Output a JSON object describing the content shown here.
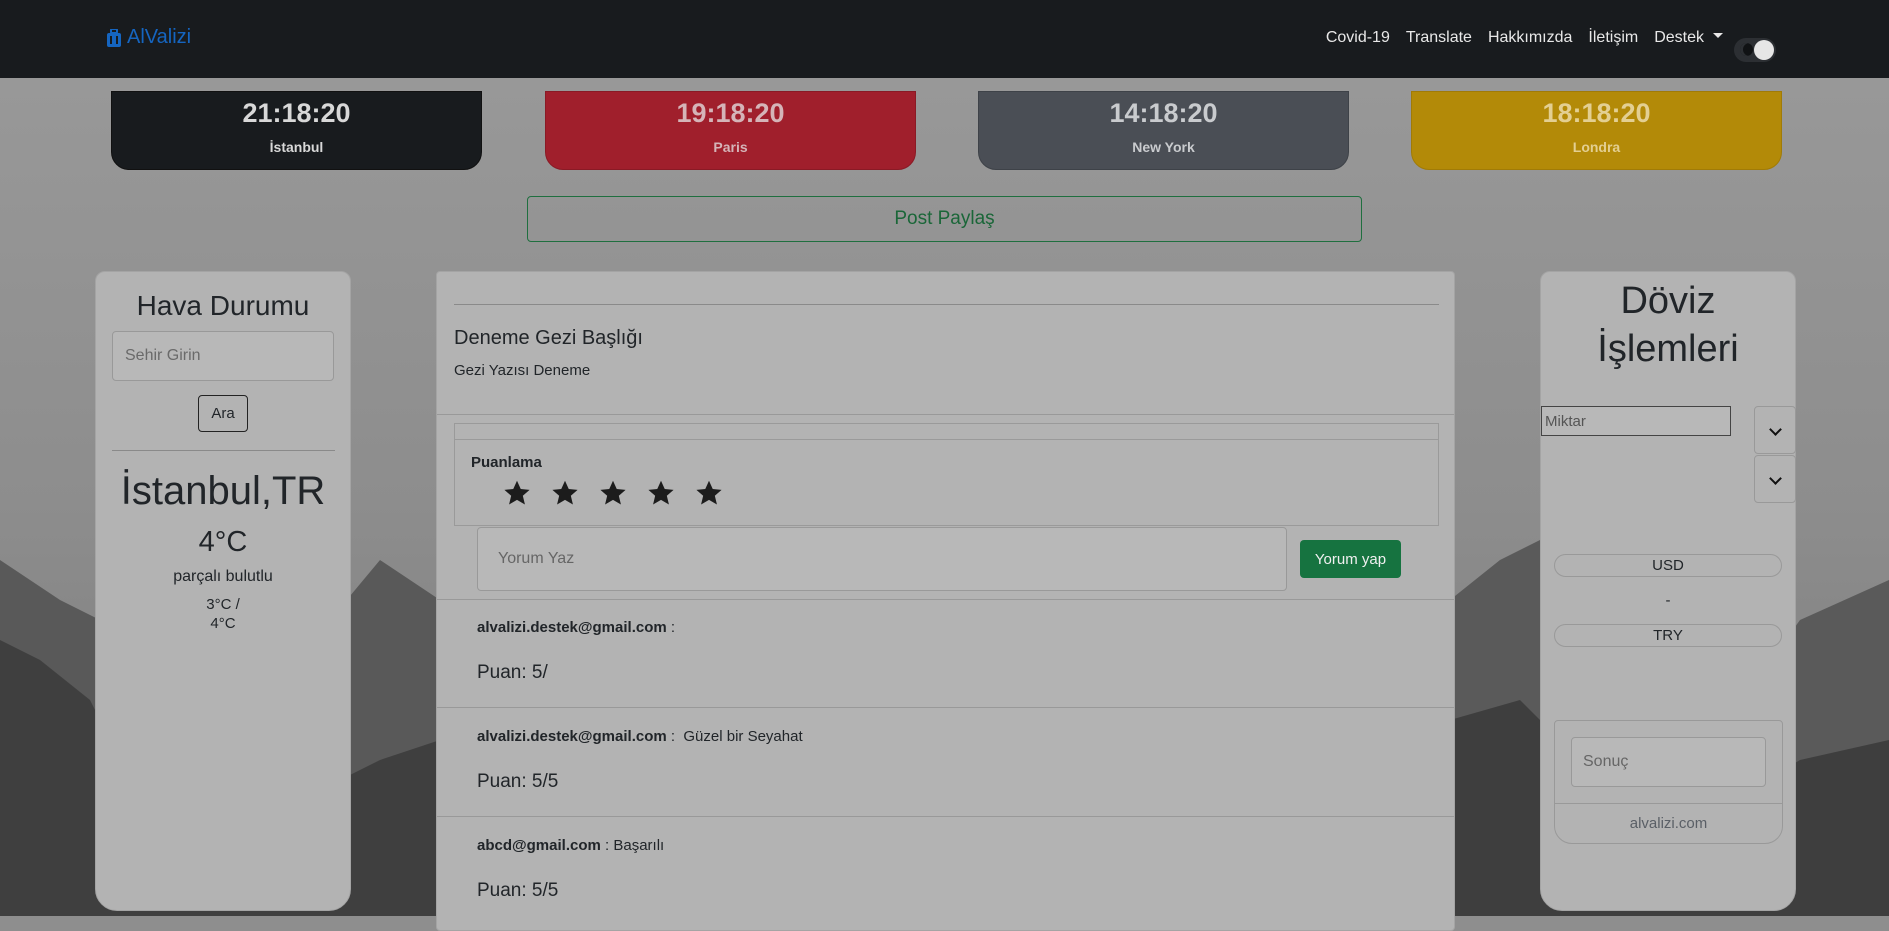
{
  "navbar": {
    "brand": "AlValizi",
    "links": [
      "Covid-19",
      "Translate",
      "Hakkımızda",
      "İletişim",
      "Destek"
    ]
  },
  "clocks": [
    {
      "time": "21:18:20",
      "city": "İstanbul"
    },
    {
      "time": "19:18:20",
      "city": "Paris"
    },
    {
      "time": "14:18:20",
      "city": "New York"
    },
    {
      "time": "18:18:20",
      "city": "Londra"
    }
  ],
  "post_share": "Post Paylaş",
  "weather": {
    "title": "Hava Durumu",
    "placeholder": "Sehir Girin",
    "search_btn": "Ara",
    "city": "İstanbul,TR",
    "temp": "4°C",
    "desc": "parçalı bulutlu",
    "range_min": "3°C /",
    "range_max": "4°C"
  },
  "post": {
    "title": "Deneme Gezi Başlığı",
    "body": "Gezi Yazısı Deneme",
    "rating_label": "Puanlama",
    "comment_placeholder": "Yorum Yaz",
    "comment_btn": "Yorum yap",
    "comments": [
      {
        "user": "alvalizi.destek@gmail.com",
        "sep": " :",
        "text": "",
        "score": "Puan: 5/"
      },
      {
        "user": "alvalizi.destek@gmail.com",
        "sep": " :  ",
        "text": "Güzel bir Seyahat",
        "score": "Puan: 5/5"
      },
      {
        "user": "abcd@gmail.com",
        "sep": " : ",
        "text": "Başarılı",
        "score": "Puan: 5/5"
      }
    ]
  },
  "fx": {
    "title_line1": "Döviz",
    "title_line2": "İşlemleri",
    "amount_placeholder": "Miktar",
    "from": "USD",
    "dash": "-",
    "to": "TRY",
    "result_placeholder": "Sonuç",
    "footer": "alvalizi.com"
  },
  "colors": {
    "navbar": "#181b1e",
    "brand": "#1565c0",
    "success": "#167340",
    "danger": "#a01f2c",
    "warning": "#b38a08",
    "secondary": "#4a4e55"
  }
}
